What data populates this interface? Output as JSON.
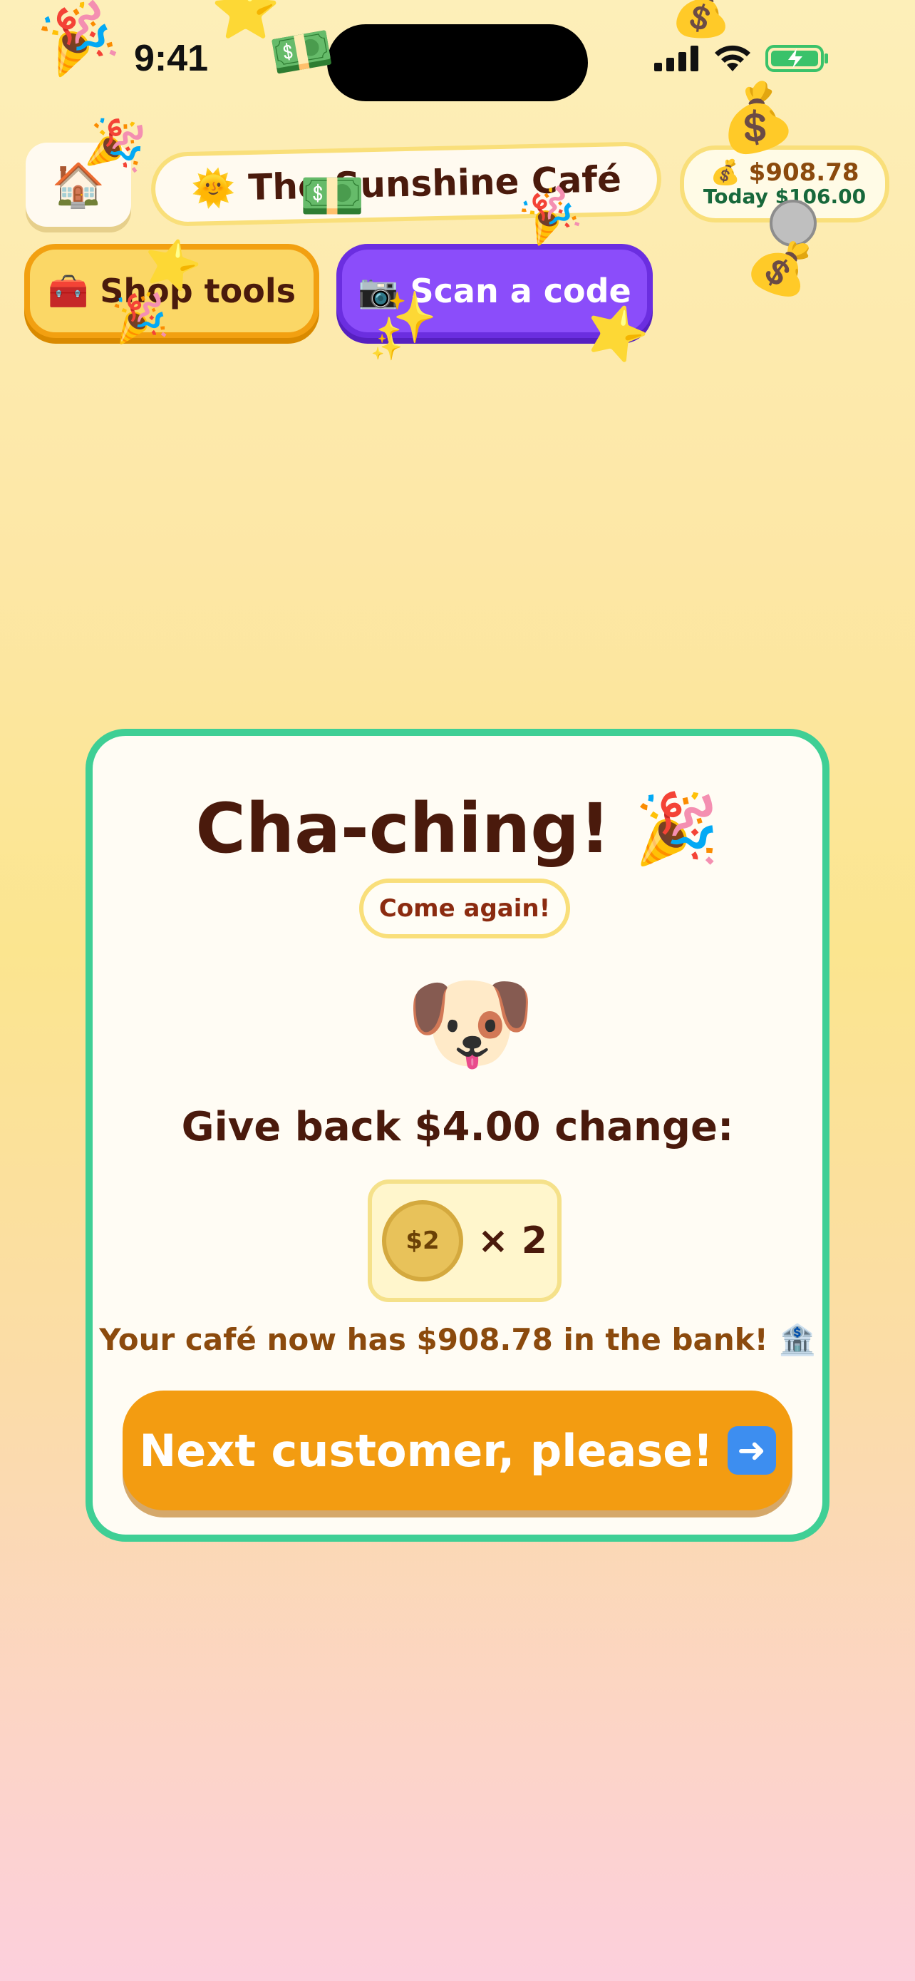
{
  "status_bar": {
    "time": "9:41",
    "icons": [
      "signal-icon",
      "wifi-icon",
      "battery-charging-icon"
    ]
  },
  "header": {
    "home_icon": "🏠",
    "cafe_icon": "🌞",
    "cafe_name": "The Sunshine Café",
    "money_icon": "💰",
    "money_total": "$908.78",
    "money_today": "Today $106.00",
    "shop_icon": "🧰",
    "shop_label": "Shop tools",
    "scan_icon": "📷",
    "scan_label": "Scan a code"
  },
  "card": {
    "title": "Cha-ching!",
    "title_icon": "🎉",
    "badge": "Come again!",
    "customer_avatar": "🐶",
    "change_text": "Give back $4.00 change:",
    "coin_label": "$2",
    "coin_multiplier": "× 2",
    "bank_text": "Your café now has $908.78 in the bank!",
    "bank_icon": "🏦",
    "next_label": "Next customer, please!",
    "next_icon": "➡️"
  },
  "colors": {
    "card_border": "#3fcf95",
    "shop_button": "#fbd766",
    "scan_button": "#8b4dfa",
    "next_button": "#f39c11",
    "text_dark": "#4a1a0c",
    "today_green": "#17683b"
  }
}
